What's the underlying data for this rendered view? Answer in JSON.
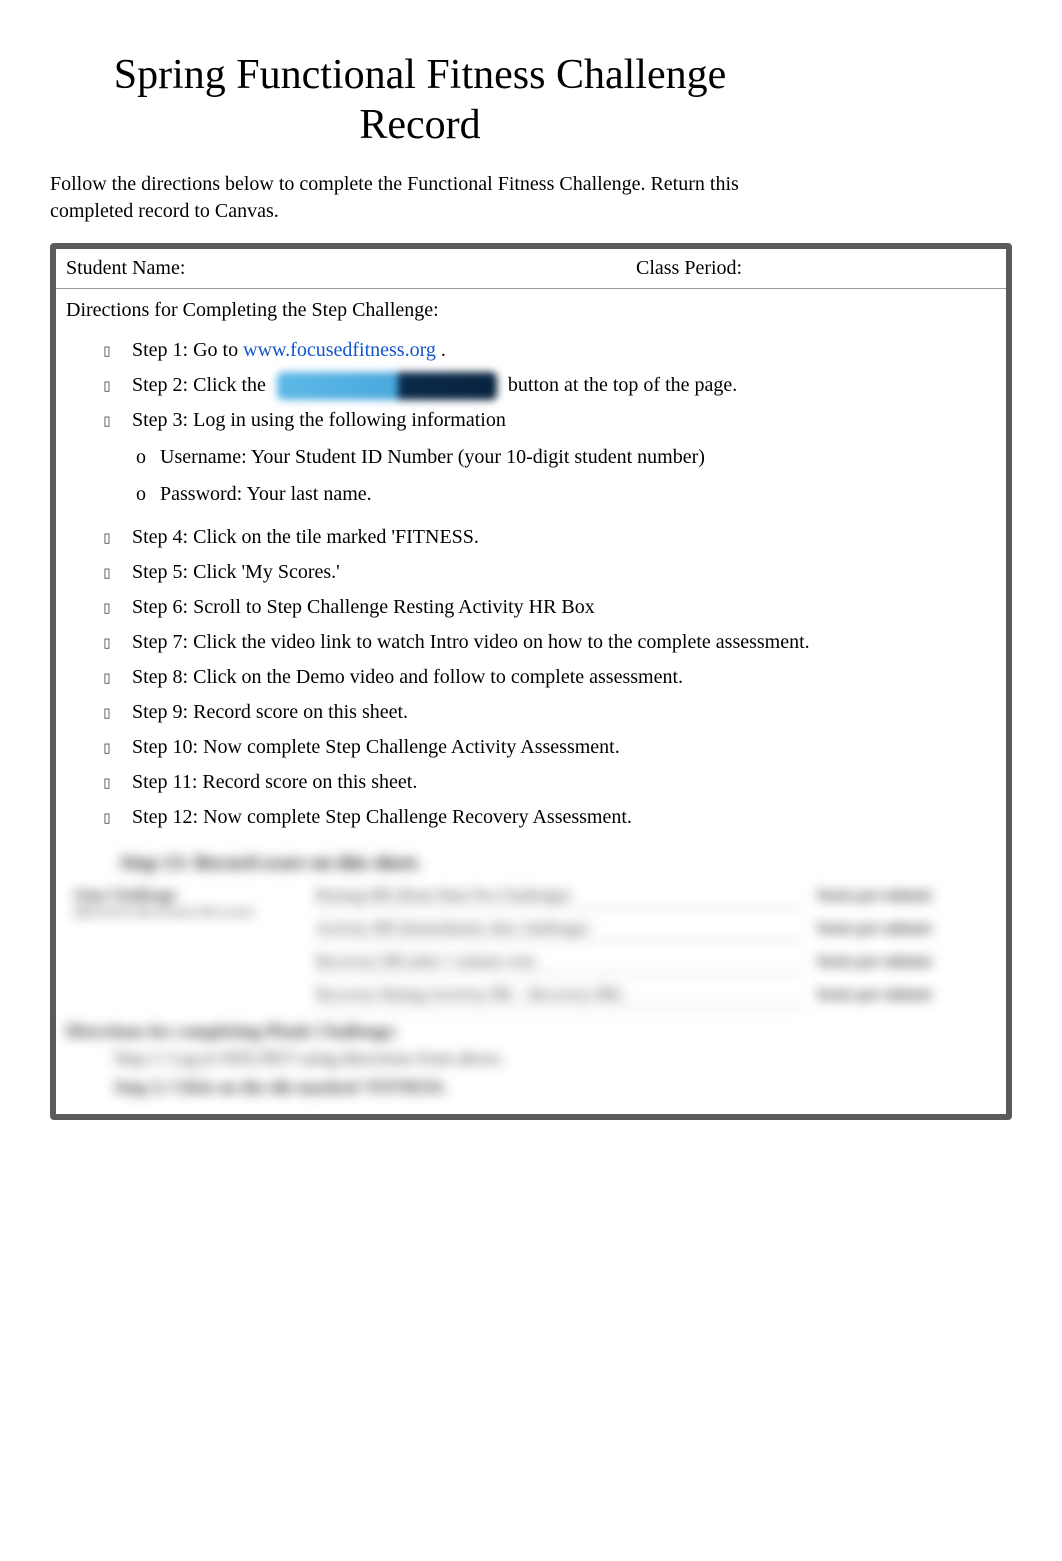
{
  "title": "Spring Functional Fitness Challenge Record",
  "intro": "Follow the directions below to complete the Functional Fitness Challenge. Return this completed record to Canvas.",
  "header": {
    "student_name_label": "Student Name:",
    "class_period_label": "Class Period:"
  },
  "step_section_title": "Directions for Completing the Step Challenge:",
  "link_url": "www.focusedfitness.org",
  "steps": {
    "s1_pre": "Step 1: Go to ",
    "s1_post": " .",
    "s2_pre": "Step 2: Click the ",
    "s2_post": " button at the top of the page.",
    "s3": "Step 3: Log in using the following information",
    "s3a": "Username:  Your Student ID Number (your 10-digit student number)",
    "s3b": "Password:  Your last name.",
    "s4": "Step 4: Click on the tile marked 'FITNESS.",
    "s5": "Step 5: Click 'My Scores.'",
    "s6": "Step 6: Scroll to Step Challenge Resting Activity HR Box",
    "s7": "Step 7: Click the video link to watch Intro video on how to the complete assessment.",
    "s8": "Step 8: Click on the Demo video and follow to complete assessment.",
    "s9": "Step 9: Record score on this sheet.",
    "s10": "Step 10: Now complete Step Challenge Activity Assessment.",
    "s11": "Step 11: Record score on this sheet.",
    "s12": "Step 12: Now complete Step Challenge Recovery Assessment."
  },
  "blurred": {
    "step13": "Step 13: Record score on this sheet.",
    "left_title": "Step Challenge",
    "left_sub": "(Record in the boxes) All scores",
    "row1_mid": "Resting HR (Heart Rate Pre-Challenge)",
    "row2_mid": "Activity HR (Immediately after challenge)",
    "row3_mid": "Recovery HR (after 1 minute rest)",
    "row4_mid": "Recovery Rating (Activity HR − Recovery HR)",
    "unit": "beats per minute",
    "sec2_title": "Directions for completing Plank Challenge:",
    "sec2_s1": "Step 1: Log in WELNET using directions from above.",
    "sec2_s2": "Step 2: Click on the tile marked 'FITNESS."
  }
}
